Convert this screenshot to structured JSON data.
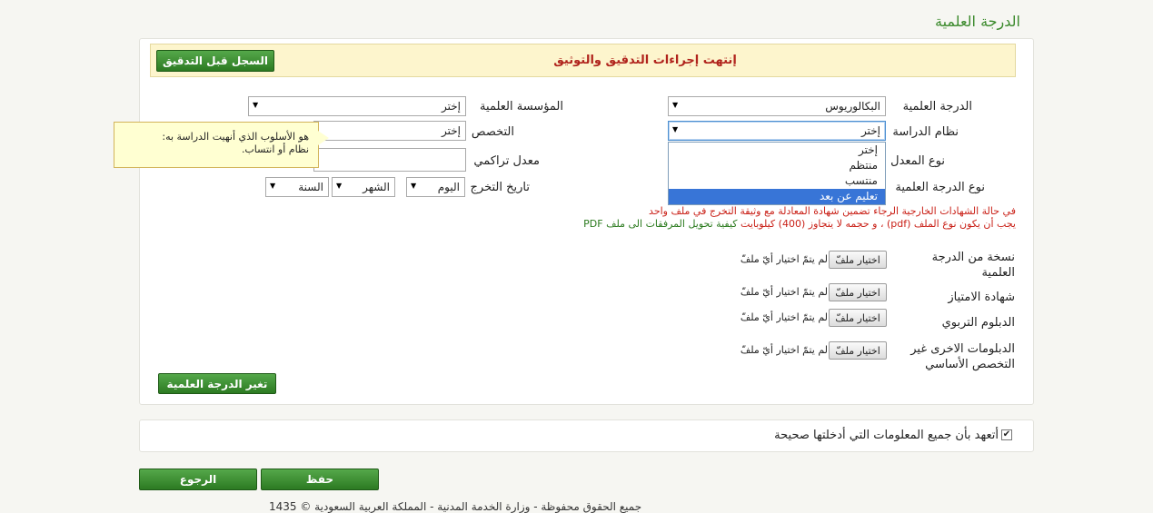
{
  "page": {
    "title": "الدرجة العلمية"
  },
  "banner": {
    "message": "إنتهت إجراءات التدقيق والتوثيق",
    "history_button": "السجل قبل التدقيق"
  },
  "form": {
    "degree": {
      "label": "الدرجة العلمية",
      "value": "البكالوريوس"
    },
    "institution": {
      "label": "المؤسسة العلمية",
      "value": "إختر"
    },
    "study_system": {
      "label": "نظام الدراسة",
      "value": "إختر",
      "options": [
        "إختر",
        "منتظم",
        "منتسب",
        "تعليم عن بعد"
      ],
      "highlighted_index": 3
    },
    "specialization": {
      "label": "التخصص",
      "value": "إختر"
    },
    "gpa_type": {
      "label": "نوع المعدل"
    },
    "cumulative_gpa": {
      "label": "معدل تراكمي",
      "value": ""
    },
    "degree_type": {
      "label": "نوع الدرجة العلمية"
    },
    "graduation_date": {
      "label": "تاريخ التخرج",
      "day": "اليوم",
      "month": "الشهر",
      "year": "السنة"
    }
  },
  "tooltip": {
    "line1": "هو الأسلوب الذي أنهيت الدراسة به:",
    "line2": "نظام أو انتساب."
  },
  "notes": {
    "foreign_certs": "في حالة الشهادات الخارجية الرجاء تضمين شهادة المعادلة مع وثيقة التخرج في ملف واحد",
    "file_rule": "يجب أن يكون نوع الملف (pdf) ، و حجمه لا يتجاوز (400) كيلوبايت",
    "convert_link": "كيفية تحويل المرفقات الى ملف PDF"
  },
  "attachments": {
    "choose_label": "اختيار ملفّ",
    "no_file": "لم يتمّ اختيار أيّ ملفّ",
    "items": [
      {
        "line1": "نسخة من الدرجة",
        "line2": "العلمية"
      },
      {
        "line1": "شهادة الامتياز",
        "line2": ""
      },
      {
        "line1": "الدبلوم التربوي",
        "line2": ""
      },
      {
        "line1": "الدبلومات الاخرى غير",
        "line2": "التخصص الأساسي"
      }
    ]
  },
  "change_degree_button": "تغير الدرجة العلمية",
  "pledge": {
    "text": "أتعهد بأن جميع المعلومات التي أدخلتها صحيحة",
    "checked": true
  },
  "actions": {
    "save": "حفظ",
    "back": "الرجوع"
  },
  "footer": {
    "text": "جميع الحقوق محفوظة - وزارة الخدمة المدنية - المملكة العربية السعودية © 1435"
  },
  "colors": {
    "accent_green": "#3b8a2c",
    "error_red": "#c91f16",
    "banner_bg": "#fdf5cd"
  }
}
